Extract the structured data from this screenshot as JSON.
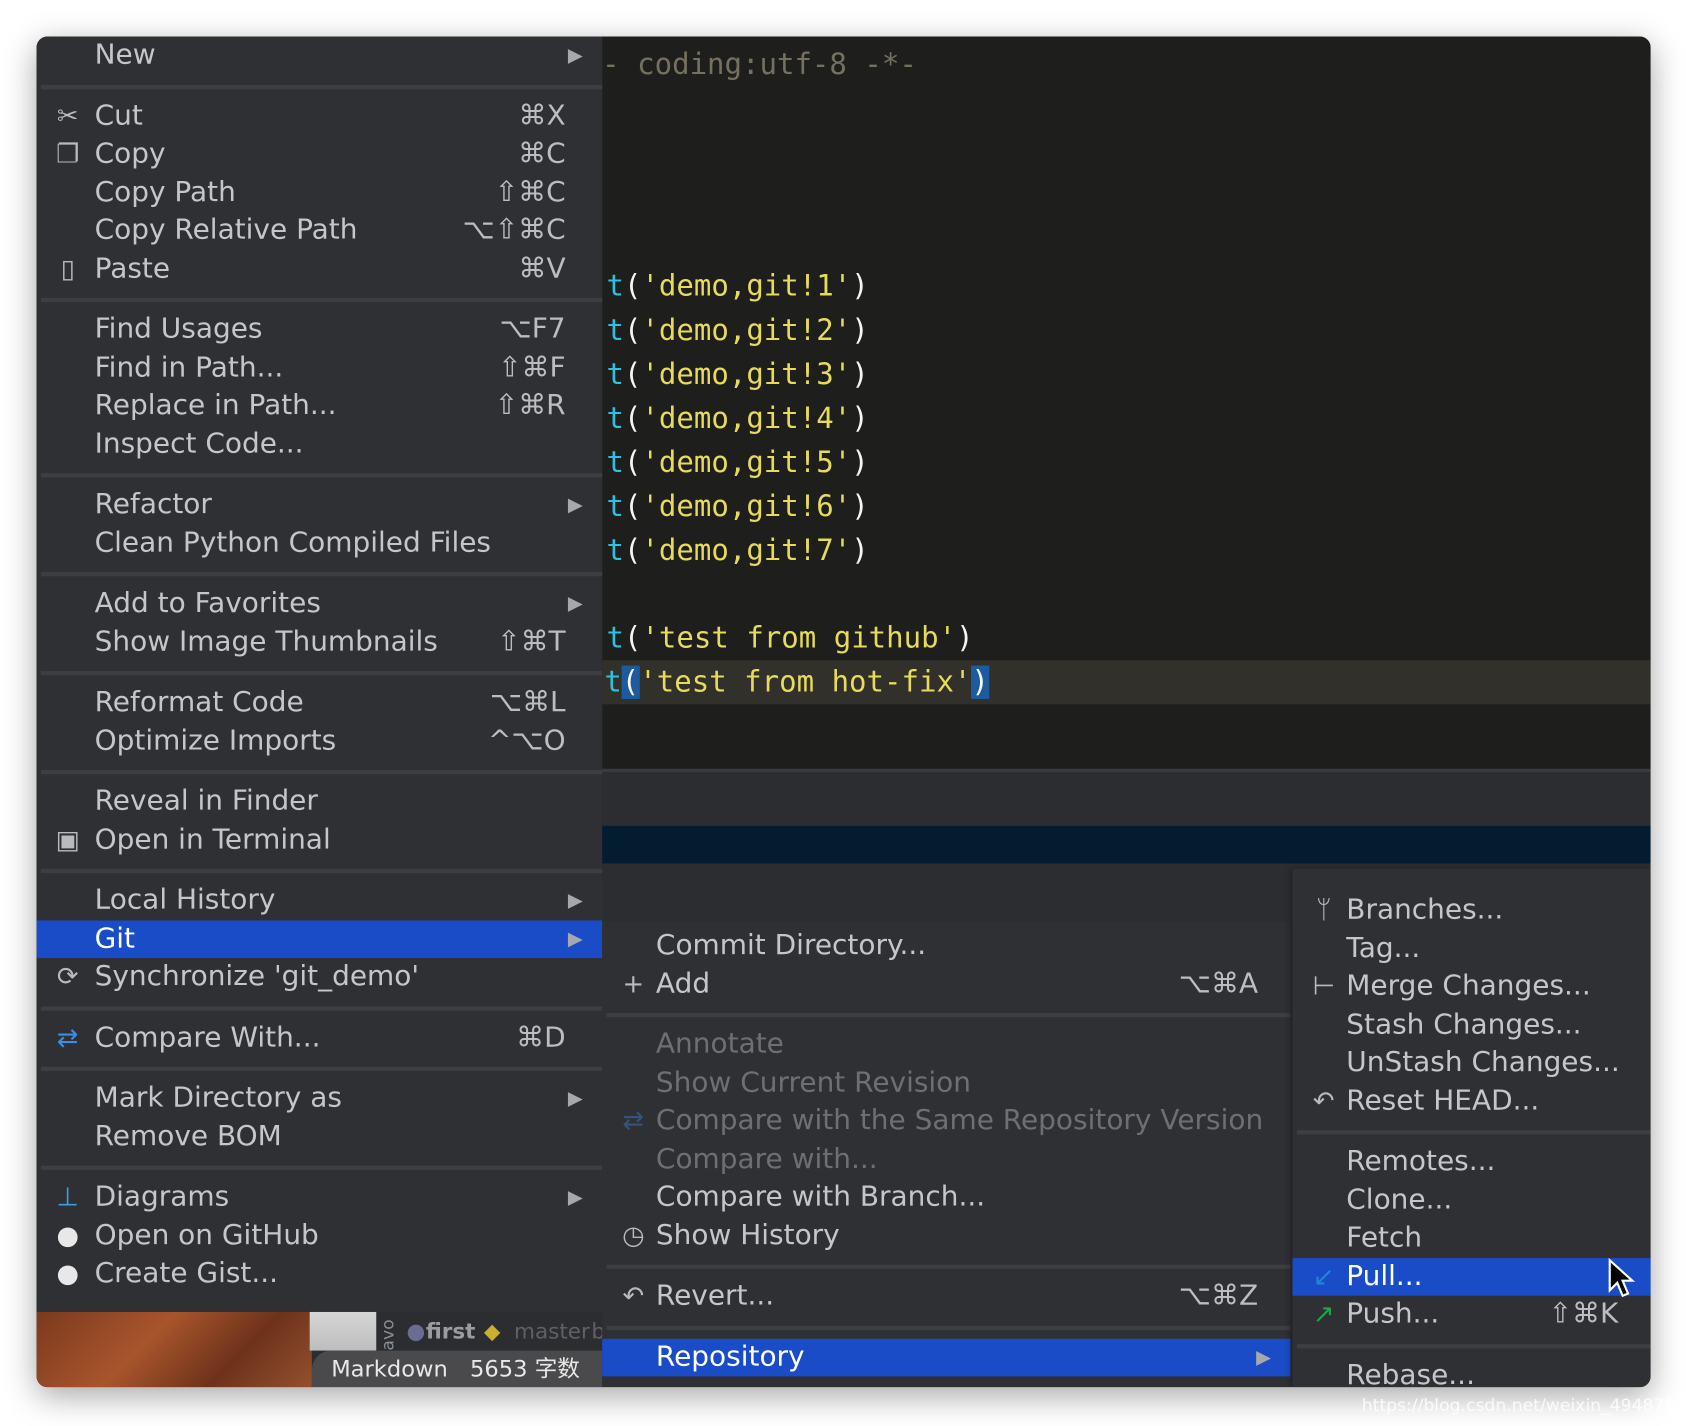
{
  "editor": {
    "header_comment": "- coding:utf-8 -*-",
    "lines": [
      {
        "fn": "t",
        "open": "(",
        "str": "'demo,git!1'",
        "close": ")"
      },
      {
        "fn": "t",
        "open": "(",
        "str": "'demo,git!2'",
        "close": ")"
      },
      {
        "fn": "t",
        "open": "(",
        "str": "'demo,git!3'",
        "close": ")"
      },
      {
        "fn": "t",
        "open": "(",
        "str": "'demo,git!4'",
        "close": ")"
      },
      {
        "fn": "t",
        "open": "(",
        "str": "'demo,git!5'",
        "close": ")"
      },
      {
        "fn": "t",
        "open": "(",
        "str": "'demo,git!6'",
        "close": ")"
      },
      {
        "fn": "t",
        "open": "(",
        "str": "'demo,git!7'",
        "close": ")"
      },
      {
        "fn": "t",
        "open": "(",
        "str": "'test from github'",
        "close": ")"
      },
      {
        "fn": "t",
        "open": "(",
        "str": "'test from hot-fix'",
        "close": ")"
      }
    ]
  },
  "status": {
    "vcs_label": "avo",
    "commit": "first",
    "branch": "master",
    "branch_tail": "b",
    "mode": "Markdown",
    "word_count": "5653 字数"
  },
  "context_menu": [
    {
      "label": "New",
      "arrow": true
    },
    {
      "sep": true
    },
    {
      "label": "Cut",
      "shortcut": "⌘X",
      "icon": "scissors-icon"
    },
    {
      "label": "Copy",
      "shortcut": "⌘C",
      "icon": "copy-icon"
    },
    {
      "label": "Copy Path",
      "shortcut": "⇧⌘C"
    },
    {
      "label": "Copy Relative Path",
      "shortcut": "⌥⇧⌘C"
    },
    {
      "label": "Paste",
      "shortcut": "⌘V",
      "icon": "clipboard-icon"
    },
    {
      "sep": true
    },
    {
      "label": "Find Usages",
      "shortcut": "⌥F7"
    },
    {
      "label": "Find in Path...",
      "shortcut": "⇧⌘F"
    },
    {
      "label": "Replace in Path...",
      "shortcut": "⇧⌘R"
    },
    {
      "label": "Inspect Code..."
    },
    {
      "sep": true
    },
    {
      "label": "Refactor",
      "arrow": true
    },
    {
      "label": "Clean Python Compiled Files"
    },
    {
      "sep": true
    },
    {
      "label": "Add to Favorites",
      "arrow": true
    },
    {
      "label": "Show Image Thumbnails",
      "shortcut": "⇧⌘T"
    },
    {
      "sep": true
    },
    {
      "label": "Reformat Code",
      "shortcut": "⌥⌘L"
    },
    {
      "label": "Optimize Imports",
      "shortcut": "^⌥O"
    },
    {
      "sep": true
    },
    {
      "label": "Reveal in Finder"
    },
    {
      "label": "Open in Terminal",
      "icon": "terminal-icon"
    },
    {
      "sep": true
    },
    {
      "label": "Local History",
      "arrow": true
    },
    {
      "label": "Git",
      "arrow": true,
      "selected": true
    },
    {
      "label": "Synchronize 'git_demo'",
      "icon": "sync-icon"
    },
    {
      "sep": true
    },
    {
      "label": "Compare With...",
      "shortcut": "⌘D",
      "icon": "compare-icon"
    },
    {
      "sep": true
    },
    {
      "label": "Mark Directory as",
      "arrow": true
    },
    {
      "label": "Remove BOM"
    },
    {
      "sep": true
    },
    {
      "label": "Diagrams",
      "arrow": true,
      "icon": "diagram-icon"
    },
    {
      "label": "Open on GitHub",
      "icon": "github-icon"
    },
    {
      "label": "Create Gist...",
      "icon": "github-icon"
    }
  ],
  "git_menu": [
    {
      "label": "Commit Directory..."
    },
    {
      "label": "Add",
      "shortcut": "⌥⌘A",
      "icon": "plus-icon"
    },
    {
      "sep": true
    },
    {
      "label": "Annotate",
      "disabled": true
    },
    {
      "label": "Show Current Revision",
      "disabled": true
    },
    {
      "label": "Compare with the Same Repository Version",
      "disabled": true,
      "icon": "compare-icon"
    },
    {
      "label": "Compare with...",
      "disabled": true
    },
    {
      "label": "Compare with Branch..."
    },
    {
      "label": "Show History",
      "icon": "clock-icon"
    },
    {
      "sep": true
    },
    {
      "label": "Revert...",
      "shortcut": "⌥⌘Z",
      "icon": "revert-icon"
    },
    {
      "sep": true
    },
    {
      "label": "Repository",
      "arrow": true,
      "selected": true
    }
  ],
  "repository_menu": [
    {
      "label": "Branches...",
      "icon": "branch-icon"
    },
    {
      "label": "Tag..."
    },
    {
      "label": "Merge Changes...",
      "icon": "merge-icon"
    },
    {
      "label": "Stash Changes..."
    },
    {
      "label": "UnStash Changes..."
    },
    {
      "label": "Reset HEAD...",
      "icon": "revert-icon"
    },
    {
      "sep": true
    },
    {
      "label": "Remotes..."
    },
    {
      "label": "Clone..."
    },
    {
      "label": "Fetch"
    },
    {
      "label": "Pull...",
      "selected": true,
      "icon": "pull-arrow-icon"
    },
    {
      "label": "Push...",
      "shortcut": "⇧⌘K",
      "icon": "push-arrow-icon"
    },
    {
      "sep": true
    },
    {
      "label": "Rebase..."
    }
  ],
  "watermark": "https://blog.csdn.net/weixin_494875",
  "colors": {
    "selection": "#1a4cc7",
    "menu_bg": "#2e3034",
    "editor_bg": "#1e1f1c",
    "string": "#e6db5a",
    "function": "#2fc0e0"
  }
}
